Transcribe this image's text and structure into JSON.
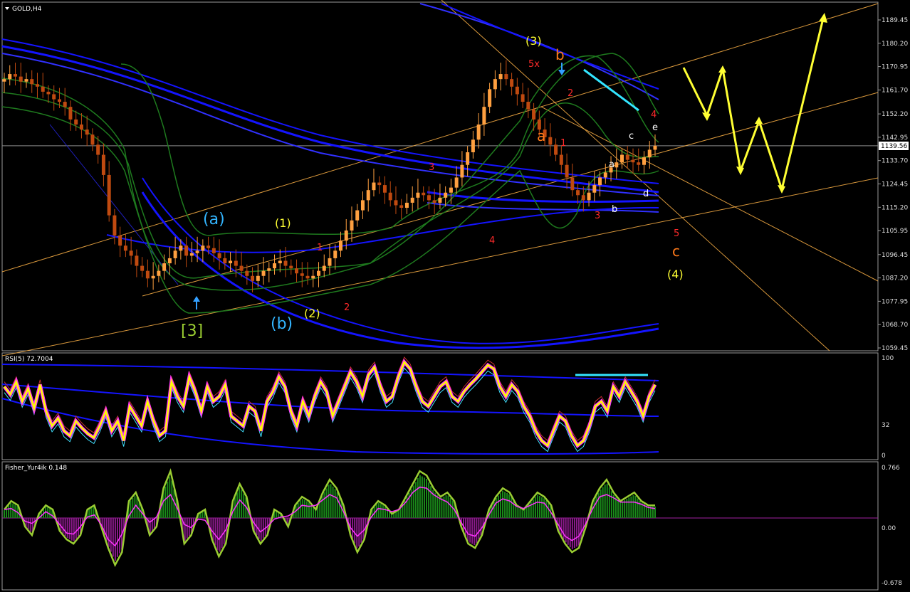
{
  "colors": {
    "background": "#000000",
    "frame": "#9a9a9a",
    "bull_candle": "#ffa040",
    "bear_candle": "#c04a10",
    "bands_blue": "#1414ff",
    "bands_green": "#1e7a1e",
    "channel": "#ffb347",
    "annot_yellow": "#ffff33",
    "annot_red": "#ff2a2a",
    "annot_orange": "#ff7a1a",
    "annot_cyan": "#33b5ff",
    "annot_white": "#ffffff",
    "annot_green": "#9acd32",
    "rsi_main": "#ffff00",
    "rsi_glow": "#ff33ff",
    "fisher_line": "#9acd32",
    "fisher_signal": "#ff33ff",
    "fisher_pos": "#1a8a1a",
    "fisher_neg": "#8a1a8a"
  },
  "main_pane": {
    "title": "GOLD,H4",
    "current_price": "1139.56",
    "price_axis": [
      "1189.45",
      "1180.20",
      "1170.95",
      "1161.70",
      "1152.20",
      "1142.95",
      "1133.70",
      "1124.45",
      "1115.20",
      "1105.95",
      "1096.45",
      "1087.20",
      "1077.95",
      "1068.70",
      "1059.45"
    ]
  },
  "rsi_pane": {
    "title": "RSI(5) 72.7004",
    "axis": [
      "100",
      "32",
      "0"
    ]
  },
  "fisher_pane": {
    "title": "Fisher_Yur4ik 0.148",
    "axis": [
      "0.766",
      "0.00",
      "-0.678"
    ]
  },
  "annotations": {
    "wave_a_cyan": "(a)",
    "wave_b_cyan": "(b)",
    "wave_3_green": "[3]",
    "wave_1_yellow": "(1)",
    "wave_2_yellow": "(2)",
    "wave_3_yellow": "(3)",
    "wave_4_yellow": "(4)",
    "red_1_a": "1",
    "red_2_a": "2",
    "red_3_a": "3",
    "red_4_a": "4",
    "red_5x": "5x",
    "orange_b": "b",
    "orange_a": "a",
    "red_2_b": "2",
    "red_1_b": "1",
    "red_3_b": "3",
    "red_4_b": "4",
    "red_5_b": "5",
    "orange_c": "c",
    "white_a": "a",
    "white_b": "b",
    "white_c": "c",
    "white_d": "d",
    "white_e": "e"
  },
  "chart_data": [
    {
      "type": "candlestick",
      "title": "GOLD,H4",
      "ylim": [
        1055,
        1195
      ],
      "ticks": [
        1189.45,
        1180.2,
        1170.95,
        1161.7,
        1152.2,
        1142.95,
        1133.7,
        1124.45,
        1115.2,
        1105.95,
        1096.45,
        1087.2,
        1077.95,
        1068.7,
        1059.45
      ],
      "last": 1139.56,
      "series": [
        {
          "name": "price",
          "values": [
            1166,
            1168,
            1167,
            1165,
            1166,
            1164,
            1163,
            1161,
            1160,
            1158,
            1157,
            1155,
            1150,
            1148,
            1146,
            1144,
            1140,
            1136,
            1128,
            1112,
            1104,
            1100,
            1098,
            1096,
            1092,
            1090,
            1087,
            1088,
            1090,
            1093,
            1095,
            1098,
            1100,
            1096,
            1097,
            1098,
            1100,
            1099,
            1097,
            1095,
            1093,
            1094,
            1092,
            1090,
            1088,
            1086,
            1088,
            1090,
            1091,
            1093,
            1094,
            1092,
            1091,
            1089,
            1088,
            1087,
            1088,
            1090,
            1092,
            1095,
            1098,
            1102,
            1106,
            1110,
            1114,
            1118,
            1122,
            1125,
            1124,
            1121,
            1118,
            1116,
            1115,
            1117,
            1119,
            1121,
            1120,
            1118,
            1117,
            1119,
            1121,
            1123,
            1127,
            1132,
            1137,
            1142,
            1148,
            1155,
            1162,
            1166,
            1168,
            1166,
            1163,
            1160,
            1157,
            1154,
            1150,
            1146,
            1143,
            1140,
            1136,
            1132,
            1127,
            1122,
            1120,
            1118,
            1121,
            1124,
            1127,
            1129,
            1131,
            1133,
            1136,
            1134,
            1133,
            1132,
            1135,
            1138,
            1139.56
          ]
        }
      ]
    },
    {
      "type": "line",
      "title": "RSI(5) 72.7004",
      "ylim": [
        0,
        100
      ],
      "series": [
        {
          "name": "RSI",
          "values": [
            70,
            62,
            75,
            55,
            68,
            48,
            72,
            45,
            30,
            38,
            25,
            20,
            35,
            28,
            22,
            18,
            30,
            45,
            25,
            35,
            15,
            50,
            40,
            30,
            55,
            35,
            20,
            25,
            75,
            60,
            50,
            80,
            65,
            45,
            70,
            55,
            60,
            72,
            40,
            35,
            30,
            50,
            45,
            25,
            55,
            65,
            80,
            70,
            45,
            30,
            55,
            40,
            60,
            75,
            65,
            40,
            55,
            70,
            85,
            75,
            60,
            82,
            90,
            70,
            55,
            60,
            80,
            95,
            88,
            70,
            55,
            50,
            60,
            70,
            75,
            60,
            55,
            65,
            72,
            78,
            85,
            92,
            88,
            70,
            60,
            72,
            65,
            50,
            40,
            25,
            15,
            10,
            25,
            40,
            35,
            20,
            10,
            15,
            30,
            50,
            55,
            45,
            70,
            60,
            75,
            65,
            55,
            40,
            60,
            72
          ]
        }
      ]
    },
    {
      "type": "bar",
      "title": "Fisher_Yur4ik 0.148",
      "ylim": [
        -0.678,
        0.766
      ],
      "series": [
        {
          "name": "Fisher",
          "values": [
            0.1,
            0.2,
            0.15,
            -0.1,
            -0.2,
            0.05,
            0.15,
            0.1,
            -0.15,
            -0.25,
            -0.3,
            -0.2,
            0.1,
            0.15,
            -0.1,
            -0.35,
            -0.55,
            -0.4,
            0.2,
            0.3,
            0.1,
            -0.2,
            -0.1,
            0.35,
            0.55,
            0.2,
            -0.3,
            -0.2,
            0.05,
            0.1,
            -0.25,
            -0.45,
            -0.3,
            0.2,
            0.4,
            0.25,
            -0.15,
            -0.3,
            -0.2,
            0.1,
            0.05,
            -0.1,
            0.15,
            0.25,
            0.2,
            0.1,
            0.3,
            0.45,
            0.35,
            0.15,
            -0.2,
            -0.4,
            -0.25,
            0.1,
            0.2,
            0.15,
            0.05,
            0.1,
            0.25,
            0.4,
            0.55,
            0.5,
            0.35,
            0.25,
            0.3,
            0.2,
            -0.1,
            -0.3,
            -0.35,
            -0.2,
            0.1,
            0.25,
            0.35,
            0.3,
            0.15,
            0.1,
            0.2,
            0.3,
            0.25,
            0.15,
            -0.15,
            -0.3,
            -0.4,
            -0.35,
            -0.1,
            0.2,
            0.35,
            0.45,
            0.3,
            0.2,
            0.25,
            0.3,
            0.2,
            0.15,
            0.148
          ]
        }
      ]
    }
  ]
}
